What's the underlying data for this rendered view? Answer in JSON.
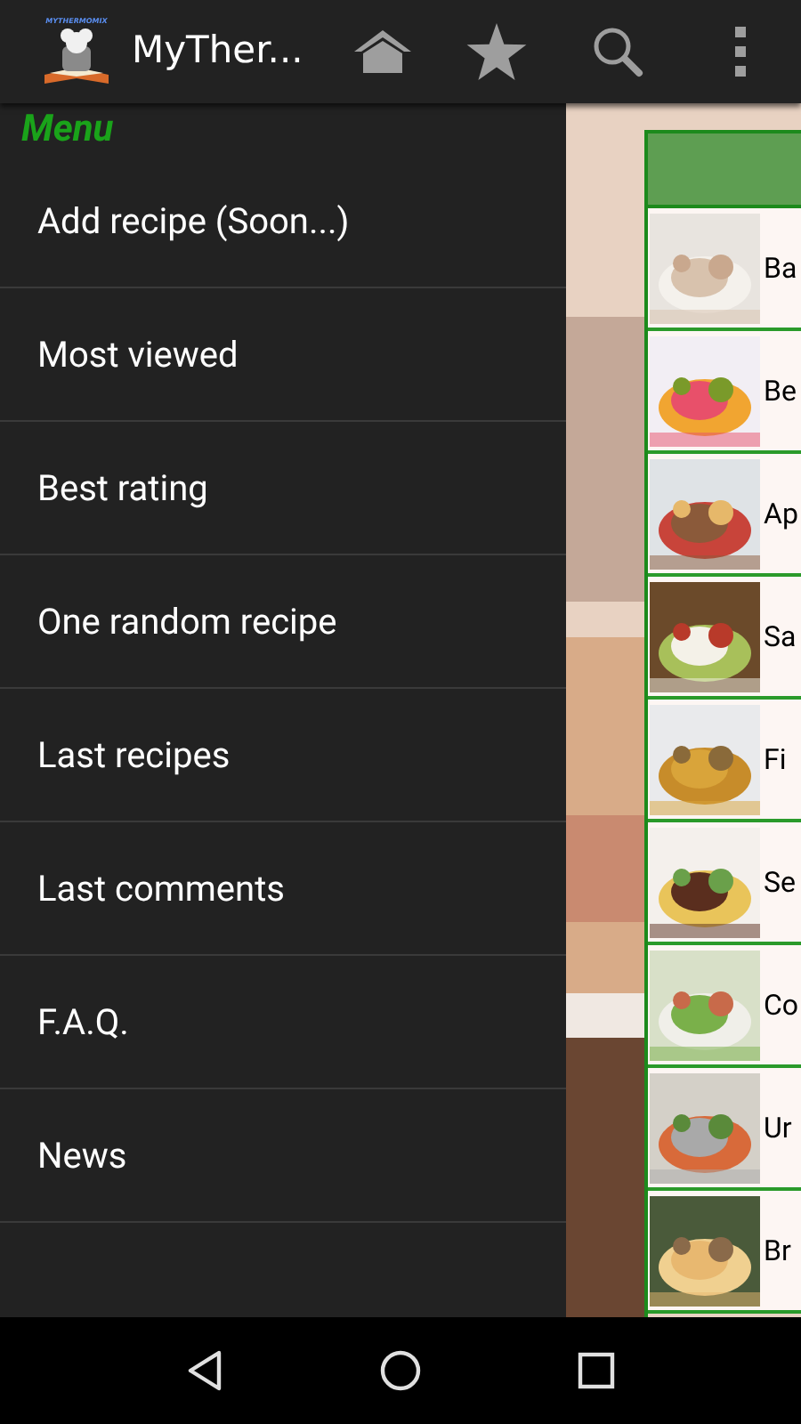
{
  "app_bar": {
    "logo_text": "MYTHERMOMIX",
    "title": "MyTher..."
  },
  "drawer": {
    "header": "Menu",
    "items": [
      {
        "label": "Add recipe (Soon...)"
      },
      {
        "label": "Most viewed"
      },
      {
        "label": "Best rating"
      },
      {
        "label": "One random recipe"
      },
      {
        "label": "Last recipes"
      },
      {
        "label": "Last comments"
      },
      {
        "label": "F.A.Q."
      },
      {
        "label": "News"
      }
    ]
  },
  "categories": [
    {
      "label": "Ba",
      "kind": "picture"
    },
    {
      "label": "Be",
      "kind": "picture"
    },
    {
      "label": "Ap",
      "kind": "picture"
    },
    {
      "label": "Sa",
      "kind": "picture"
    },
    {
      "label": "Fi",
      "kind": "picture"
    },
    {
      "label": "Se",
      "kind": "picture"
    },
    {
      "label": "Co",
      "kind": "picture"
    },
    {
      "label": "Ur",
      "kind": "picture"
    },
    {
      "label": "Br",
      "kind": "picture"
    }
  ]
}
